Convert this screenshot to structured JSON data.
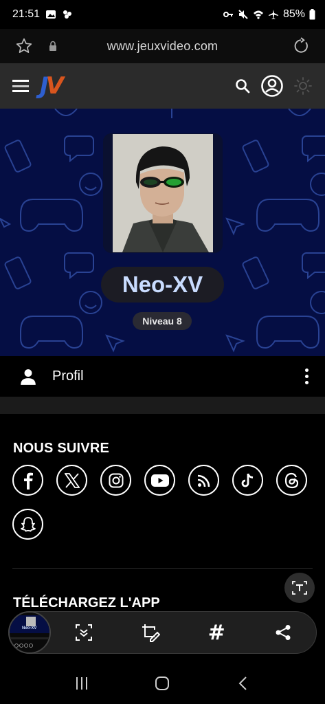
{
  "status_bar": {
    "time": "21:51",
    "battery": "85%"
  },
  "browser": {
    "url": "www.jeuxvideo.com"
  },
  "site": {
    "logo_j": "J",
    "logo_v": "V"
  },
  "profile": {
    "username": "Neo-XV",
    "level": "Niveau 8",
    "tab_label": "Profil"
  },
  "follow": {
    "title": "NOUS SUIVRE",
    "networks": [
      "facebook-icon",
      "x-icon",
      "instagram-icon",
      "youtube-icon",
      "rss-icon",
      "tiktok-icon",
      "threads-icon",
      "snapchat-icon"
    ]
  },
  "app": {
    "title": "TÉLÉCHARGEZ L'APP"
  },
  "thumbnail": {
    "label": "Neo-XV"
  },
  "toolbar": {
    "tag_symbol": "#"
  },
  "colors": {
    "banner_bg": "#050e44",
    "username_text": "#c9dcff",
    "logo_j": "#2e5fd0",
    "logo_v": "#d8551e"
  }
}
